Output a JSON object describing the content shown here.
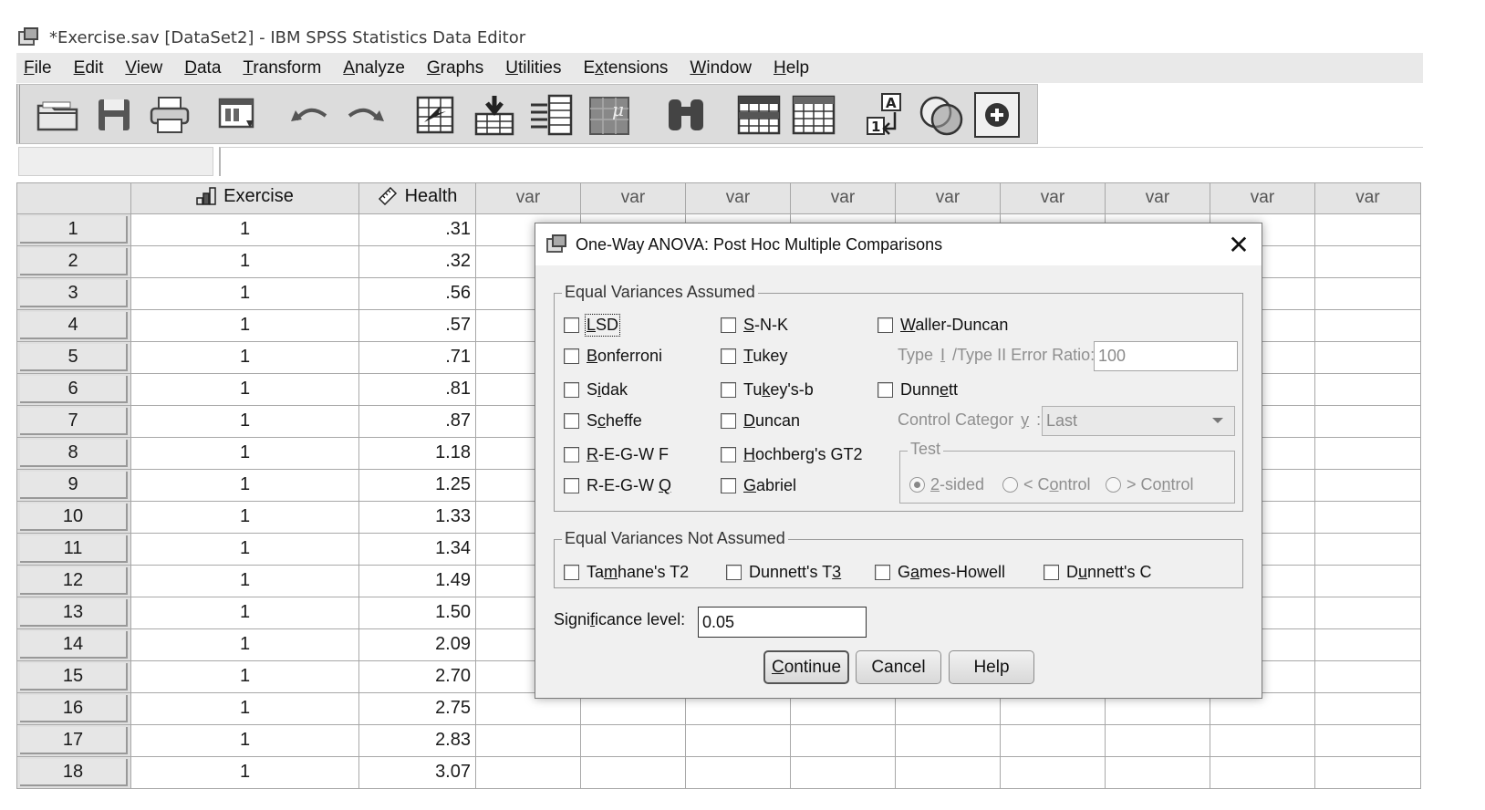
{
  "window": {
    "title": "*Exercise.sav [DataSet2] - IBM SPSS Statistics Data Editor"
  },
  "menubar": {
    "items": [
      {
        "pre": "",
        "ul": "F",
        "post": "ile"
      },
      {
        "pre": "",
        "ul": "E",
        "post": "dit"
      },
      {
        "pre": "",
        "ul": "V",
        "post": "iew"
      },
      {
        "pre": "",
        "ul": "D",
        "post": "ata"
      },
      {
        "pre": "",
        "ul": "T",
        "post": "ransform"
      },
      {
        "pre": "",
        "ul": "A",
        "post": "nalyze"
      },
      {
        "pre": "",
        "ul": "G",
        "post": "raphs"
      },
      {
        "pre": "",
        "ul": "U",
        "post": "tilities"
      },
      {
        "pre": "E",
        "ul": "x",
        "post": "tensions"
      },
      {
        "pre": "",
        "ul": "W",
        "post": "indow"
      },
      {
        "pre": "",
        "ul": "H",
        "post": "elp"
      }
    ]
  },
  "toolbar": {
    "icons": [
      "open-folder-icon",
      "save-icon",
      "print-icon",
      "dialog-recall-icon",
      "undo-icon",
      "redo-icon",
      "goto-case-icon",
      "goto-variable-icon",
      "variables-icon",
      "run-descriptives-icon",
      "find-icon",
      "insert-cases-icon",
      "insert-variable-icon",
      "value-labels-icon",
      "use-sets-icon",
      "show-all-variables-icon"
    ]
  },
  "grid": {
    "columns": [
      {
        "name": "Exercise",
        "icon": "ordinal-bar-icon"
      },
      {
        "name": "Health",
        "icon": "scale-ruler-icon"
      },
      {
        "name": "var"
      },
      {
        "name": "var"
      },
      {
        "name": "var"
      },
      {
        "name": "var"
      },
      {
        "name": "var"
      },
      {
        "name": "var"
      },
      {
        "name": "var"
      },
      {
        "name": "var"
      },
      {
        "name": "var"
      }
    ],
    "rows": [
      {
        "n": "1",
        "exercise": "1",
        "health": ".31"
      },
      {
        "n": "2",
        "exercise": "1",
        "health": ".32"
      },
      {
        "n": "3",
        "exercise": "1",
        "health": ".56"
      },
      {
        "n": "4",
        "exercise": "1",
        "health": ".57"
      },
      {
        "n": "5",
        "exercise": "1",
        "health": ".71"
      },
      {
        "n": "6",
        "exercise": "1",
        "health": ".81"
      },
      {
        "n": "7",
        "exercise": "1",
        "health": ".87"
      },
      {
        "n": "8",
        "exercise": "1",
        "health": "1.18"
      },
      {
        "n": "9",
        "exercise": "1",
        "health": "1.25"
      },
      {
        "n": "10",
        "exercise": "1",
        "health": "1.33"
      },
      {
        "n": "11",
        "exercise": "1",
        "health": "1.34"
      },
      {
        "n": "12",
        "exercise": "1",
        "health": "1.49"
      },
      {
        "n": "13",
        "exercise": "1",
        "health": "1.50"
      },
      {
        "n": "14",
        "exercise": "1",
        "health": "2.09"
      },
      {
        "n": "15",
        "exercise": "1",
        "health": "2.70"
      },
      {
        "n": "16",
        "exercise": "1",
        "health": "2.75"
      },
      {
        "n": "17",
        "exercise": "1",
        "health": "2.83"
      },
      {
        "n": "18",
        "exercise": "1",
        "health": "3.07"
      }
    ]
  },
  "dialog": {
    "title": "One-Way ANOVA: Post Hoc Multiple Comparisons",
    "equal_assumed": {
      "label": "Equal Variances Assumed",
      "lsd": {
        "pre": "",
        "ul": "L",
        "post": "SD"
      },
      "bonferroni": {
        "pre": "",
        "ul": "B",
        "post": "onferroni"
      },
      "sidak": {
        "pre": "S",
        "ul": "i",
        "post": "dak"
      },
      "scheffe": {
        "pre": "S",
        "ul": "c",
        "post": "heffe"
      },
      "regwf": {
        "pre": "",
        "ul": "R",
        "post": "-E-G-W F"
      },
      "regwq": {
        "pre": "R-E-G-W ",
        "ul": "Q",
        "post": ""
      },
      "snk": {
        "pre": "",
        "ul": "S",
        "post": "-N-K"
      },
      "tukey": {
        "pre": "",
        "ul": "T",
        "post": "ukey"
      },
      "tukeyb": {
        "pre": "Tu",
        "ul": "k",
        "post": "ey's-b"
      },
      "duncan": {
        "pre": "",
        "ul": "D",
        "post": "uncan"
      },
      "hochberg": {
        "pre": "",
        "ul": "H",
        "post": "ochberg's GT2"
      },
      "gabriel": {
        "pre": "",
        "ul": "G",
        "post": "abriel"
      },
      "waller": {
        "pre": "",
        "ul": "W",
        "post": "aller-Duncan"
      },
      "ratio_label": {
        "pre": "Type ",
        "ul": "I",
        "post": "/Type II Error Ratio:"
      },
      "ratio_value": "100",
      "dunnett": {
        "pre": "Dunn",
        "ul": "e",
        "post": "tt"
      },
      "control_label": {
        "pre": "Control Categor",
        "ul": "y",
        "post": " :"
      },
      "control_value": "Last",
      "test_label": "Test",
      "two_sided": {
        "pre": "",
        "ul": "2",
        "post": "-sided"
      },
      "lt_control": {
        "pre": "< C",
        "ul": "o",
        "post": "ntrol"
      },
      "gt_control": {
        "pre": "> Co",
        "ul": "n",
        "post": "trol"
      }
    },
    "not_assumed": {
      "label": "Equal Variances Not Assumed",
      "tamhane": {
        "pre": "Ta",
        "ul": "m",
        "post": "hane's T2"
      },
      "dunnett_t3": {
        "pre": "Dunnett's T",
        "ul": "3",
        "post": ""
      },
      "games_howell": {
        "pre": "G",
        "ul": "a",
        "post": "mes-Howell"
      },
      "dunnett_c": {
        "pre": "D",
        "ul": "u",
        "post": "nnett's C"
      }
    },
    "significance": {
      "pre": "Signi",
      "ul": "f",
      "post": "icance level:",
      "value": "0.05"
    },
    "buttons": {
      "continue": {
        "pre": "",
        "ul": "C",
        "post": "ontinue"
      },
      "cancel": "Cancel",
      "help": "Help"
    }
  }
}
